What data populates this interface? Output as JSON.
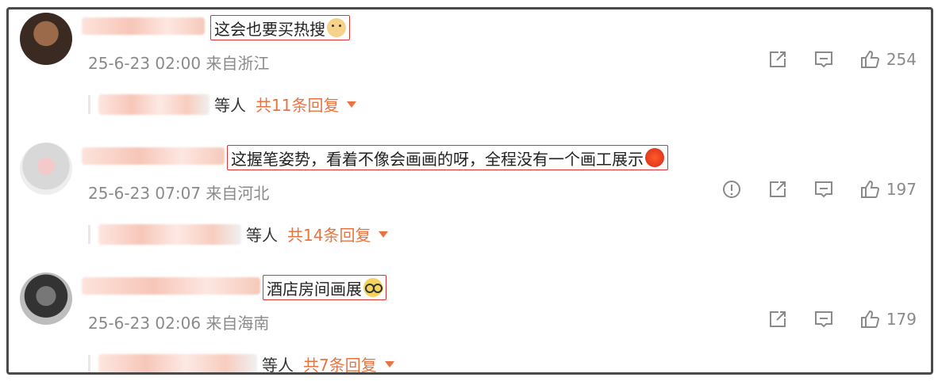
{
  "comments": [
    {
      "text": "这会也要买热搜",
      "emoji": "doge-emoji",
      "date": "25-6-23 02:00",
      "location": "来自浙江",
      "likes": "254",
      "reply_suffix": "等人",
      "reply_count": "共11条回复"
    },
    {
      "text": "这握笔姿势，看着不像会画画的呀，全程没有一个画工展示",
      "emoji": "angry-emoji",
      "date": "25-6-23 07:07",
      "location": "来自河北",
      "likes": "197",
      "reply_suffix": "等人",
      "reply_count": "共14条回复"
    },
    {
      "text": "酒店房间画展",
      "emoji": "glasses-emoji",
      "date": "25-6-23 02:06",
      "location": "来自海南",
      "likes": "179",
      "reply_suffix": "等人",
      "reply_count": "共7条回复"
    }
  ],
  "icons": {
    "report": "report-icon",
    "share": "share-icon",
    "comment": "comment-icon",
    "like": "thumbs-up-icon"
  },
  "colors": {
    "accent": "#eb7340",
    "highlight_border": "#dd3333",
    "meta_text": "#8a8a8a"
  }
}
